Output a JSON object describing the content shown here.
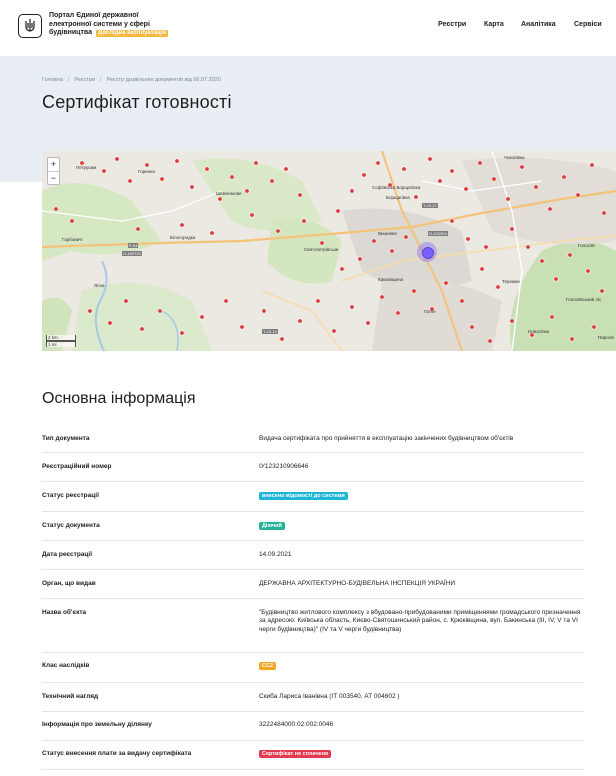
{
  "header": {
    "portal_title": "Портал Єдиної державної електронної системи у сфері будівництва",
    "beta_label": "Дослідна експлуатація",
    "nav": [
      "Реєстри",
      "Карта",
      "Аналітика",
      "Сервіси"
    ]
  },
  "breadcrumb": [
    "Головна",
    "Реєстри",
    "Реєстр дозвільних документів від 06.07.2020"
  ],
  "page_title": "Сертифікат готовності",
  "map": {
    "zoom_in": "+",
    "zoom_out": "−",
    "scale_km": "2 km",
    "scale_mi": "1 mi",
    "labels": [
      "Петрушки",
      "Горенка",
      "Шевченкове",
      "Білогородка",
      "Горбовичі",
      "Ясна",
      "Святопетрівське",
      "Вишневе",
      "Крюківщина",
      "Гатне",
      "Софіївська Борщагівка",
      "Борщагівка",
      "Чоколівка",
      "Голосіїв",
      "Теремки",
      "Новосілки",
      "Пирогів",
      "Голосіївський ліс"
    ],
    "road_labels": [
      "Р-04",
      "О-100720",
      "Т-10-27",
      "О-101304",
      "Т-10-12"
    ]
  },
  "main": {
    "section_title": "Основна інформація",
    "rows": [
      {
        "key": "Тип документа",
        "value": "Видача сертифіката про прийняття в експлуатацію закінчених будівництвом об'єктів"
      },
      {
        "key": "Реєстраційний номер",
        "value": "ІУ123210906646"
      },
      {
        "key": "Статус реєстрації",
        "badge": "внесено відомості до системи",
        "badge_color": "#1fb5d8"
      },
      {
        "key": "Статус документа",
        "badge": "Діючий",
        "badge_color": "#23b39a"
      },
      {
        "key": "Дата реєстрації",
        "value": "14.09.2021"
      },
      {
        "key": "Орган, що видав",
        "value": "ДЕРЖАВНА АРХІТЕКТУРНО-БУДІВЕЛЬНА ІНСПЕКЦІЯ УКРАЇНИ"
      },
      {
        "key": "Назва об'єкта",
        "value": "\"Будівництво житлового комплексу з вбудовано-прибудованими приміщеннями громадського призначення за адресою: Київська область, Києво-Святошинський район, с. Крюківщина, вул. Бакинська (ІІІ, IV, V та VI черги будівництва)\" (IV та V черги будівництва)"
      },
      {
        "key": "Клас наслідків",
        "badge": "СС2",
        "badge_color": "#f5a623"
      },
      {
        "key": "Технічний нагляд",
        "value": "Скиба Лариса Іванівна (ІТ 003540, АТ 004602 )"
      },
      {
        "key": "Інформація про земельну ділянку",
        "value": "3222484000:02:002:0046"
      },
      {
        "key": "Статус внесення плати за видачу сертифіката",
        "badge": "Сертифікат не сплачено",
        "badge_color": "#e53950"
      }
    ]
  },
  "colors": {
    "accent_purple": "#7b61ff",
    "marker_red": "#d93a3a",
    "hero_bg": "#e8eef4"
  }
}
